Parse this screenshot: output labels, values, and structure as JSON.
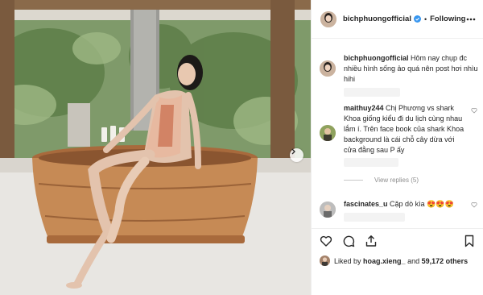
{
  "post": {
    "username": "bichphuongofficial",
    "follow_label": "Following",
    "separator": "•",
    "caption": "Hôm nay chụp đc nhiều hình sống ảo quá nên post hơi nhìu hihi"
  },
  "comments": [
    {
      "username": "maithuy244",
      "text": "Chị Phương vs shark Khoa giống kiểu đi du lịch cùng nhau lắm í. Trên face book của shark Khoa background là cái chỗ cây dừa với cửa đằng sau P ấy"
    },
    {
      "username": "fascinates_u",
      "text": "Cặp dò kìa 😍😍😍"
    }
  ],
  "view_replies_label": "View replies (5)",
  "likes": {
    "prefix": "Liked by",
    "user": "hoag.xieng_",
    "conjunction": "and",
    "count": "59,172 others"
  },
  "icons": [
    "more-icon",
    "verified-icon",
    "heart-icon",
    "comment-icon",
    "share-icon",
    "bookmark-icon",
    "chevron-right-icon"
  ],
  "colors": {
    "verified": "#3897f0",
    "text": "#262626",
    "muted": "#8e8e8e",
    "border": "#efefef"
  }
}
